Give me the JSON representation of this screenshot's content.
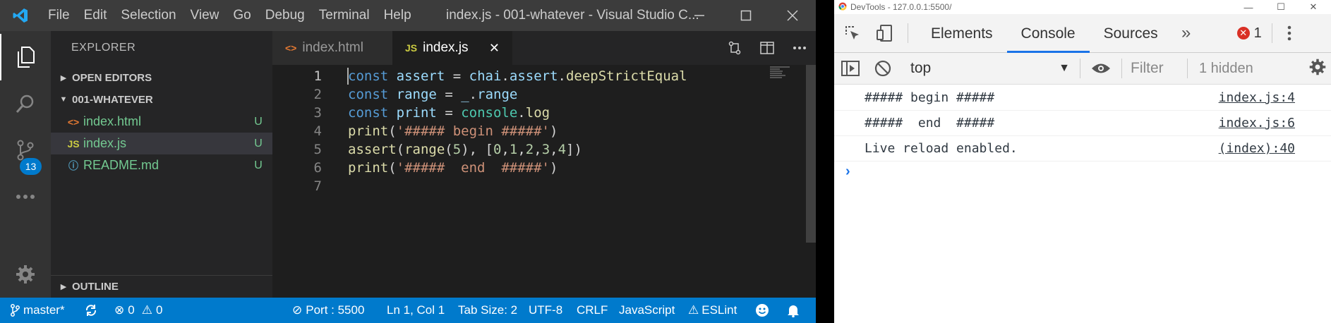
{
  "vscode": {
    "menu": [
      "File",
      "Edit",
      "Selection",
      "View",
      "Go",
      "Debug",
      "Terminal",
      "Help"
    ],
    "window_title": "index.js - 001-whatever - Visual Studio C...",
    "scm_badge": "13",
    "sidebar": {
      "title": "EXPLORER",
      "open_editors": "OPEN EDITORS",
      "folder": "001-WHATEVER",
      "files": [
        {
          "name": "index.html",
          "icon": "html-file-icon",
          "status": "U"
        },
        {
          "name": "index.js",
          "icon": "js-file-icon",
          "status": "U"
        },
        {
          "name": "README.md",
          "icon": "info-file-icon",
          "status": "U"
        }
      ],
      "outline": "OUTLINE"
    },
    "tabs": [
      {
        "label": "index.html"
      },
      {
        "label": "index.js"
      }
    ],
    "code_lines": [
      "1",
      "2",
      "3",
      "4",
      "5",
      "6",
      "7"
    ],
    "statusbar": {
      "branch": "master*",
      "errors": "0",
      "warnings": "0",
      "port": "Port : 5500",
      "position": "Ln 1, Col 1",
      "tab_size": "Tab Size: 2",
      "encoding": "UTF-8",
      "eol": "CRLF",
      "language": "JavaScript",
      "linter": "ESLint"
    },
    "colors": {
      "accent": "#007acc",
      "titlebar": "#3c3c3c",
      "editor_bg": "#1e1e1e"
    }
  },
  "devtools": {
    "window_title": "DevTools - 127.0.0.1:5500/",
    "tabs": [
      "Elements",
      "Console",
      "Sources"
    ],
    "error_count": "1",
    "context": "top",
    "filter_placeholder": "Filter",
    "hidden": "1 hidden",
    "messages": [
      {
        "text": "##### begin #####",
        "source": "index.js:4"
      },
      {
        "text": "#####  end  #####",
        "source": "index.js:6"
      },
      {
        "text": "Live reload enabled.",
        "source": "(index):40"
      }
    ]
  }
}
